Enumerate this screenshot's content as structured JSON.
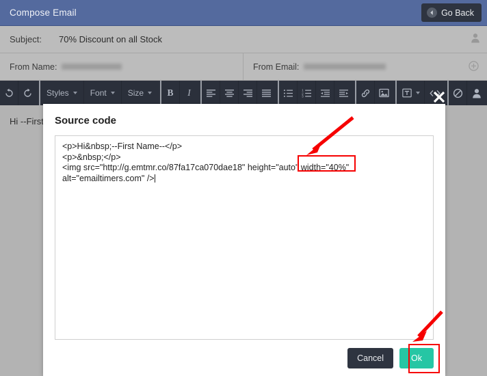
{
  "window": {
    "title": "Compose Email",
    "go_back_label": "Go Back",
    "go_back_icon": "arrow-left-circle-icon",
    "header_bg": "#546a9e",
    "accent_dark": "#2e3440"
  },
  "fields": {
    "subject_label": "Subject:",
    "subject_value": "70% Discount on all Stock",
    "from_name_label": "From Name:",
    "from_name_value": "",
    "from_email_label": "From Email:",
    "from_email_value": "",
    "person_icon": "user-icon",
    "add_icon": "plus-circle-icon"
  },
  "toolbar": {
    "groups": [
      {
        "buttons": [
          {
            "name": "undo-button",
            "icon": "undo-icon",
            "label": ""
          },
          {
            "name": "redo-button",
            "icon": "redo-icon",
            "label": ""
          }
        ]
      },
      {
        "buttons": [
          {
            "name": "styles-dropdown",
            "icon": "chevron-down-icon",
            "label": "Styles"
          },
          {
            "name": "font-dropdown",
            "icon": "chevron-down-icon",
            "label": "Font"
          },
          {
            "name": "size-dropdown",
            "icon": "chevron-down-icon",
            "label": "Size"
          }
        ]
      },
      {
        "buttons": [
          {
            "name": "bold-button",
            "icon": "bold-icon",
            "label": "B"
          },
          {
            "name": "italic-button",
            "icon": "italic-icon",
            "label": "I"
          }
        ]
      },
      {
        "buttons": [
          {
            "name": "align-left-button",
            "icon": "align-left-icon",
            "label": ""
          },
          {
            "name": "align-center-button",
            "icon": "align-center-icon",
            "label": ""
          },
          {
            "name": "align-right-button",
            "icon": "align-right-icon",
            "label": ""
          },
          {
            "name": "align-justify-button",
            "icon": "align-justify-icon",
            "label": ""
          }
        ]
      },
      {
        "buttons": [
          {
            "name": "bullet-list-button",
            "icon": "bullet-list-icon",
            "label": ""
          },
          {
            "name": "numbered-list-button",
            "icon": "numbered-list-icon",
            "label": ""
          },
          {
            "name": "outdent-button",
            "icon": "outdent-icon",
            "label": ""
          },
          {
            "name": "indent-button",
            "icon": "indent-icon",
            "label": ""
          }
        ]
      },
      {
        "buttons": [
          {
            "name": "insert-link-button",
            "icon": "link-icon",
            "label": ""
          },
          {
            "name": "insert-image-button",
            "icon": "image-icon",
            "label": ""
          }
        ]
      },
      {
        "buttons": [
          {
            "name": "merge-tag-dropdown",
            "icon": "text-box-icon",
            "label": ""
          },
          {
            "name": "source-code-button",
            "icon": "code-icon",
            "label": ""
          }
        ]
      },
      {
        "buttons": [
          {
            "name": "remove-format-button",
            "icon": "no-entry-icon",
            "label": ""
          },
          {
            "name": "personalize-button",
            "icon": "user-icon",
            "label": ""
          }
        ]
      }
    ]
  },
  "editor": {
    "preview_text": "Hi --First N"
  },
  "dialog": {
    "title": "Source code",
    "close_icon": "close-icon",
    "source_code": "<p>Hi&nbsp;--First Name--</p>\n<p>&nbsp;</p>\n<img src=\"http://g.emtmr.co/87fa17ca070dae18\" height=\"auto\" width=\"40%\" alt=\"emailtimers.com\" />",
    "cancel_label": "Cancel",
    "ok_label": "Ok",
    "ok_color": "#26c6a4"
  },
  "annotations": {
    "highlight_color": "#f60000",
    "width_highlight_text": "width=\"40%\"",
    "ok_highlight_target": "Ok"
  }
}
